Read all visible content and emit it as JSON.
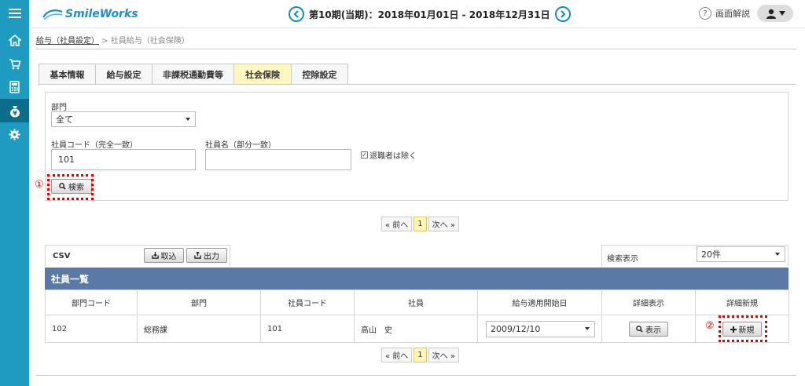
{
  "app": {
    "logo_text": "SmileWorks"
  },
  "header": {
    "period": "第10期(当期)：2018年01月01日 - 2018年12月31日",
    "help": "画面解説"
  },
  "breadcrumb": {
    "parent": "給与（社員設定）",
    "sep": " > ",
    "current": "社員給与（社会保険）"
  },
  "tabs": [
    {
      "label": "基本情報",
      "active": false
    },
    {
      "label": "給与設定",
      "active": false
    },
    {
      "label": "非課税通勤費等",
      "active": false
    },
    {
      "label": "社会保険",
      "active": true
    },
    {
      "label": "控除設定",
      "active": false
    }
  ],
  "search": {
    "dept_label": "部門",
    "dept_value": "全て",
    "code_label": "社員コード（完全一致）",
    "code_value": "101",
    "name_label": "社員名（部分一致）",
    "name_value": "",
    "exclude_retired_label": "退職者は除く",
    "exclude_retired_checked": true,
    "search_button": "検索",
    "marker1": "①"
  },
  "pager": {
    "prev": "« 前へ",
    "current": "1",
    "next": "次へ »"
  },
  "csv": {
    "label": "CSV",
    "import": "取込",
    "export": "出力"
  },
  "display": {
    "label": "検索表示",
    "value": "20件"
  },
  "table": {
    "title": "社員一覧",
    "columns": [
      "部門コード",
      "部門",
      "社員コード",
      "社員",
      "給与適用開始日",
      "詳細表示",
      "詳細新規"
    ],
    "rows": [
      {
        "dept_code": "102",
        "dept": "総務課",
        "emp_code": "101",
        "emp": "高山　史",
        "start_date": "2009/12/10",
        "view": "表示",
        "new": "新規"
      }
    ],
    "marker2": "②"
  },
  "colors": {
    "sidebar": "#1f9bc2",
    "sidebar_active": "#0d6c8a",
    "table_header": "#5b79a7",
    "active_tab": "#fff7c2",
    "marker": "#e00000"
  }
}
